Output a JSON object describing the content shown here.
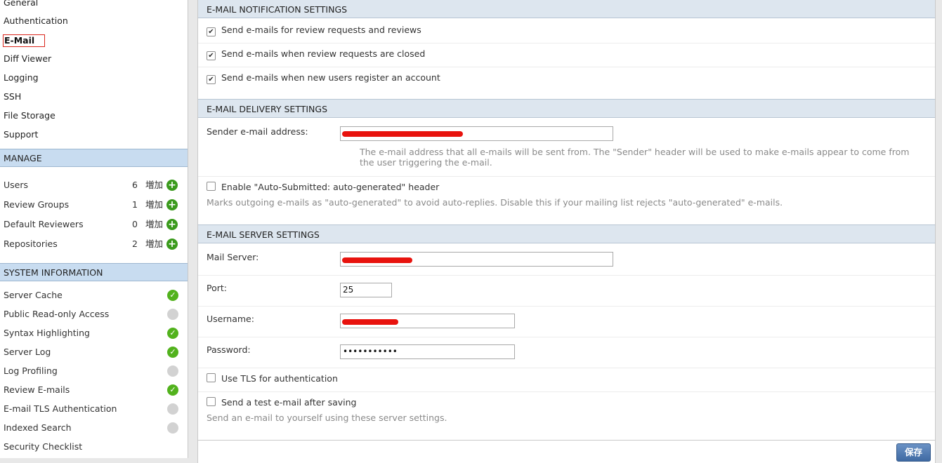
{
  "sidebar": {
    "nav": [
      "General",
      "Authentication",
      "E-Mail",
      "Diff Viewer",
      "Logging",
      "SSH",
      "File Storage",
      "Support"
    ],
    "active_index": 2,
    "manage": {
      "title": "MANAGE",
      "add_label": "増加",
      "items": [
        {
          "label": "Users",
          "count": "6"
        },
        {
          "label": "Review Groups",
          "count": "1"
        },
        {
          "label": "Default Reviewers",
          "count": "0"
        },
        {
          "label": "Repositories",
          "count": "2"
        }
      ]
    },
    "system": {
      "title": "SYSTEM INFORMATION",
      "items": [
        {
          "label": "Server Cache",
          "enabled": true
        },
        {
          "label": "Public Read-only Access",
          "enabled": false
        },
        {
          "label": "Syntax Highlighting",
          "enabled": true
        },
        {
          "label": "Server Log",
          "enabled": true
        },
        {
          "label": "Log Profiling",
          "enabled": false
        },
        {
          "label": "Review E-mails",
          "enabled": true
        },
        {
          "label": "E-mail TLS Authentication",
          "enabled": false
        },
        {
          "label": "Indexed Search",
          "enabled": false
        },
        {
          "label": "Security Checklist",
          "enabled": null
        }
      ]
    }
  },
  "notification": {
    "title": "E-MAIL NOTIFICATION SETTINGS",
    "options": [
      {
        "label": "Send e-mails for review requests and reviews",
        "checked": true
      },
      {
        "label": "Send e-mails when review requests are closed",
        "checked": true
      },
      {
        "label": "Send e-mails when new users register an account",
        "checked": true
      }
    ]
  },
  "delivery": {
    "title": "E-MAIL DELIVERY SETTINGS",
    "sender_label": "Sender e-mail address:",
    "sender_help": "The e-mail address that all e-mails will be sent from. The \"Sender\" header will be used to make e-mails appear to come from the user triggering the e-mail.",
    "auto_label": "Enable \"Auto-Submitted: auto-generated\" header",
    "auto_checked": false,
    "auto_help": "Marks outgoing e-mails as \"auto-generated\" to avoid auto-replies. Disable this if your mailing list rejects \"auto-generated\" e-mails."
  },
  "server": {
    "title": "E-MAIL SERVER SETTINGS",
    "mail_server_label": "Mail Server:",
    "port_label": "Port:",
    "port_value": "25",
    "username_label": "Username:",
    "password_label": "Password:",
    "password_value": "•••••••••••",
    "tls_label": "Use TLS for authentication",
    "tls_checked": false,
    "test_label": "Send a test e-mail after saving",
    "test_checked": false,
    "test_help": "Send an e-mail to yourself using these server settings."
  },
  "save_label": "保存",
  "colors": {
    "redaction": "#e8130e",
    "enabled": "#52b21d",
    "add": "#3a9a1c",
    "header_bg": "#c8dcf0"
  }
}
